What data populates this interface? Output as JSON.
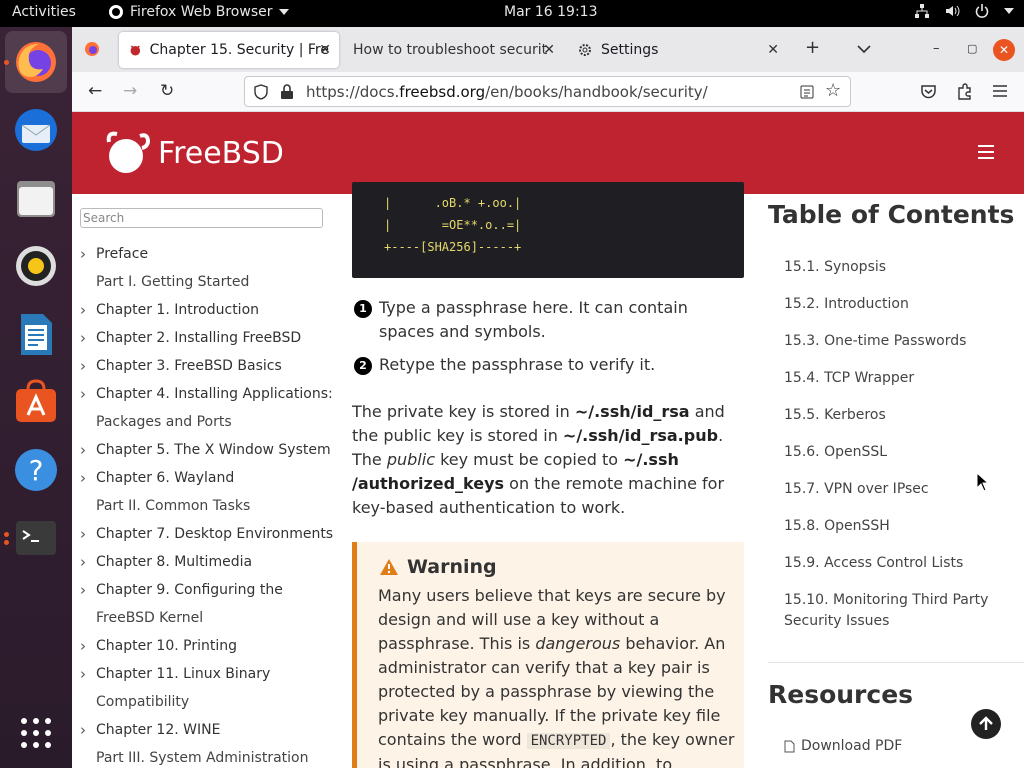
{
  "topbar": {
    "activities": "Activities",
    "app_name": "Firefox Web Browser",
    "clock": "Mar 16  19:13"
  },
  "dock": {
    "items": [
      {
        "name": "firefox"
      },
      {
        "name": "thunderbird"
      },
      {
        "name": "files"
      },
      {
        "name": "rhythmbox"
      },
      {
        "name": "libreoffice-writer"
      },
      {
        "name": "software"
      },
      {
        "name": "help"
      },
      {
        "name": "terminal"
      },
      {
        "name": "show-apps"
      }
    ]
  },
  "browser": {
    "tabs": [
      {
        "label": "Chapter 15. Security | Fre",
        "selected": true
      },
      {
        "label": "How to troubleshoot securit",
        "selected": false
      },
      {
        "label": "Settings",
        "selected": false
      }
    ],
    "url_prefix": "https://docs.",
    "url_domain": "freebsd.org",
    "url_path": "/en/books/handbook/security/"
  },
  "site": {
    "logo_text": "FreeBSD",
    "search_placeholder": "Search",
    "nav": [
      {
        "label": "Preface",
        "chevron": true
      },
      {
        "label": "Part I. Getting Started",
        "chevron": false
      },
      {
        "label": "Chapter 1. Introduction",
        "chevron": true
      },
      {
        "label": "Chapter 2. Installing FreeBSD",
        "chevron": true
      },
      {
        "label": "Chapter 3. FreeBSD Basics",
        "chevron": true
      },
      {
        "label": "Chapter 4. Installing Applications:",
        "chevron": true
      },
      {
        "label": "Packages and Ports",
        "chevron": false
      },
      {
        "label": "Chapter 5. The X Window System",
        "chevron": true
      },
      {
        "label": "Chapter 6. Wayland",
        "chevron": true
      },
      {
        "label": "Part II. Common Tasks",
        "chevron": false
      },
      {
        "label": "Chapter 7. Desktop Environments",
        "chevron": true
      },
      {
        "label": "Chapter 8. Multimedia",
        "chevron": true
      },
      {
        "label": "Chapter 9. Configuring the",
        "chevron": true
      },
      {
        "label": "FreeBSD Kernel",
        "chevron": false
      },
      {
        "label": "Chapter 10. Printing",
        "chevron": true
      },
      {
        "label": "Chapter 11. Linux Binary",
        "chevron": true
      },
      {
        "label": "Compatibility",
        "chevron": false
      },
      {
        "label": "Chapter 12. WINE",
        "chevron": true
      },
      {
        "label": "Part III. System Administration",
        "chevron": false
      }
    ]
  },
  "content": {
    "code_lines": [
      "|      .oB.* +.oo.|",
      "|       =OE**.o..=|",
      "+----[SHA256]-----+"
    ],
    "callouts": [
      {
        "num": "1",
        "text": "Type a passphrase here. It can contain spaces and symbols."
      },
      {
        "num": "2",
        "text": "Retype the passphrase to verify it."
      }
    ],
    "para": {
      "t1": "The private key is stored in ",
      "b1": "~/.ssh/id_rsa",
      "t2": " and the public key is stored in ",
      "b2": "~/.ssh/id_rsa.pub",
      "t3": ". The ",
      "i1": "public",
      "t4": " key must be copied to ",
      "b3": "~/.ssh /authorized_keys",
      "t5": " on the remote machine for key-based authentication to work."
    },
    "warning": {
      "title": "Warning",
      "t1": "Many users believe that keys are secure by design and will use a key without a passphrase. This is ",
      "i1": "dangerous",
      "t2": " behavior. An administrator can verify that a key pair is protected by a passphrase by viewing the private key manually. If the private key file contains the word ",
      "code": "ENCRYPTED",
      "t3": ", the key owner is using a passphrase. In addition, to"
    }
  },
  "toc": {
    "title": "Table of Contents",
    "items": [
      "15.1. Synopsis",
      "15.2. Introduction",
      "15.3. One-time Passwords",
      "15.4. TCP Wrapper",
      "15.5. Kerberos",
      "15.6. OpenSSL",
      "15.7. VPN over IPsec",
      "15.8. OpenSSH",
      "15.9. Access Control Lists",
      "15.10. Monitoring Third Party Security Issues"
    ],
    "resources_title": "Resources",
    "download_pdf": "Download PDF"
  },
  "colors": {
    "brand_red": "#bf2330",
    "warning_accent": "#e07d19",
    "ubuntu_orange": "#e95420"
  }
}
